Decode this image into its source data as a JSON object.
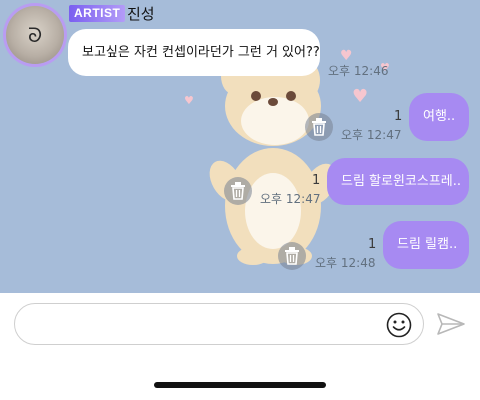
{
  "header": {
    "badge": "ARTIST",
    "artist_name": "진성"
  },
  "messages": {
    "incoming": {
      "text": "보고싶은 자컨 컨셉이라던가 그런 거 있어??",
      "time": "오후 12:46"
    },
    "outgoing": [
      {
        "text": "여행..",
        "count": "1",
        "time": "오후 12:47"
      },
      {
        "text": "드림 할로윈코스프레..",
        "count": "1",
        "time": "오후 12:47"
      },
      {
        "text": "드림 릴캠..",
        "count": "1",
        "time": "오후 12:48"
      }
    ]
  },
  "colors": {
    "chat_background": "#a6bcd9",
    "outgoing_bubble": "#a78af2",
    "badge_gradient_start": "#7a5ff0"
  },
  "icons": {
    "delete": "trash-icon",
    "emoji": "smiley-icon",
    "send": "paper-plane-icon"
  }
}
